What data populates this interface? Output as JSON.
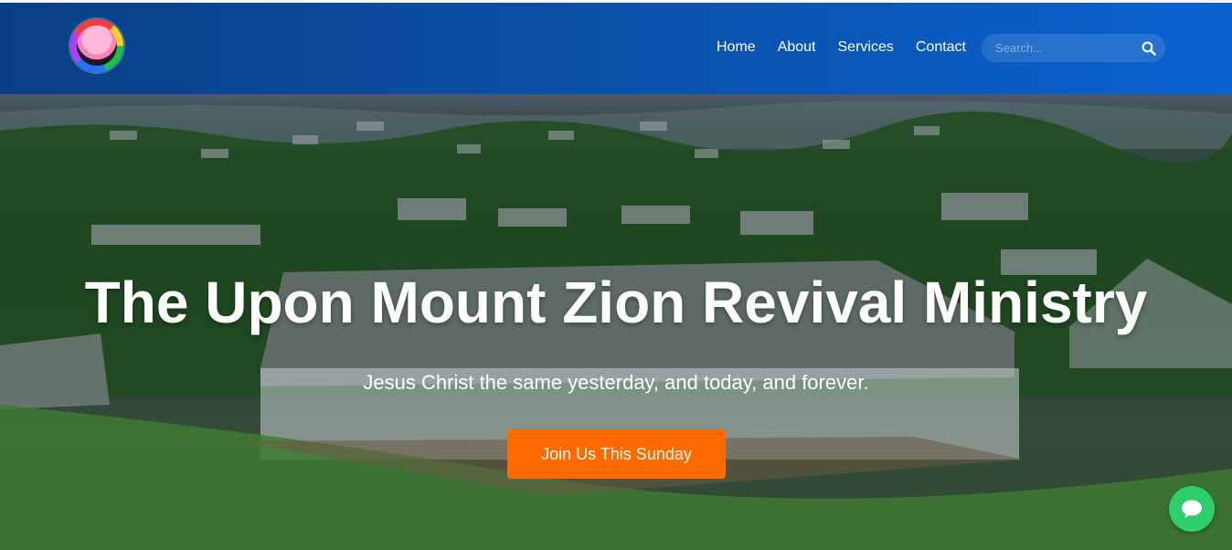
{
  "site": {
    "logo_icon": "church-logo-icon"
  },
  "nav": {
    "items": [
      {
        "label": "Home"
      },
      {
        "label": "About"
      },
      {
        "label": "Services"
      },
      {
        "label": "Contact"
      }
    ]
  },
  "search": {
    "placeholder": "Search...",
    "icon": "search-icon"
  },
  "hero": {
    "title": "The Upon Mount Zion Revival Ministry",
    "subtitle": "Jesus Christ the same yesterday, and today, and forever.",
    "cta_label": "Join Us This Sunday"
  },
  "chat": {
    "icon": "chat-bubble-icon"
  },
  "colors": {
    "header_start": "#0a3f86",
    "header_end": "#0a62d0",
    "cta": "#ff6a00",
    "chat": "#2ecf6a"
  }
}
